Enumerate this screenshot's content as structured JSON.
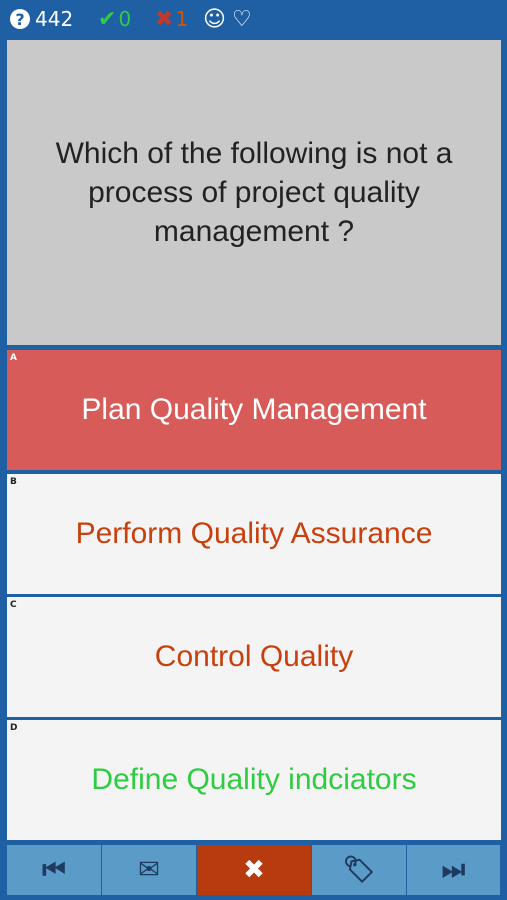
{
  "status": {
    "question_count": "442",
    "correct_count": "0",
    "wrong_count": "1",
    "check_symbol": "✔",
    "cross_symbol": "✖",
    "face_symbol": "☺",
    "heart_symbol": "♡",
    "help_symbol": "?"
  },
  "question": {
    "text": "Which of the following is not a process of project quality management ?"
  },
  "options": [
    {
      "letter": "A",
      "text": "Plan Quality Management",
      "color": "#ffffff",
      "state": "selected-wrong"
    },
    {
      "letter": "B",
      "text": "Perform Quality Assurance",
      "color": "#c8400e",
      "state": "normal"
    },
    {
      "letter": "C",
      "text": "Control Quality",
      "color": "#c8400e",
      "state": "normal"
    },
    {
      "letter": "D",
      "text": "Define Quality indciators",
      "color": "#2ecc40",
      "state": "normal"
    }
  ],
  "toolbar": {
    "first_icon": "⏮",
    "mail_icon": "✉",
    "close_icon": "✖",
    "tags_icon": "🏷",
    "last_icon": "⏭"
  },
  "colors": {
    "frame": "#1f5fa4",
    "question_bg": "#c9c9c9",
    "wrong_selected_bg": "#d65b59",
    "option_bg": "#f4f4f4",
    "toolbar_button": "#5a9bc7",
    "toolbar_active": "#b83a0f"
  }
}
